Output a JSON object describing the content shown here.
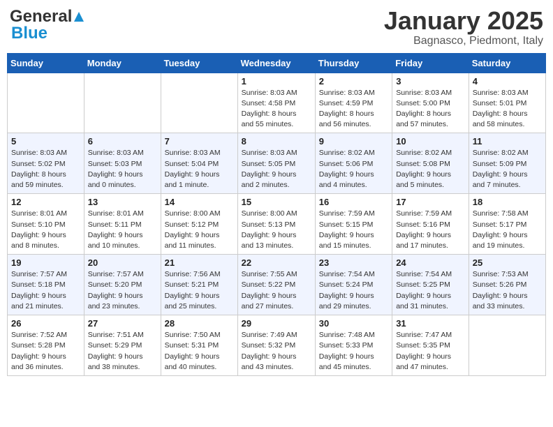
{
  "header": {
    "logo_general": "General",
    "logo_blue": "Blue",
    "month_title": "January 2025",
    "subtitle": "Bagnasco, Piedmont, Italy"
  },
  "weekdays": [
    "Sunday",
    "Monday",
    "Tuesday",
    "Wednesday",
    "Thursday",
    "Friday",
    "Saturday"
  ],
  "weeks": [
    [
      {
        "day": "",
        "info": ""
      },
      {
        "day": "",
        "info": ""
      },
      {
        "day": "",
        "info": ""
      },
      {
        "day": "1",
        "info": "Sunrise: 8:03 AM\nSunset: 4:58 PM\nDaylight: 8 hours\nand 55 minutes."
      },
      {
        "day": "2",
        "info": "Sunrise: 8:03 AM\nSunset: 4:59 PM\nDaylight: 8 hours\nand 56 minutes."
      },
      {
        "day": "3",
        "info": "Sunrise: 8:03 AM\nSunset: 5:00 PM\nDaylight: 8 hours\nand 57 minutes."
      },
      {
        "day": "4",
        "info": "Sunrise: 8:03 AM\nSunset: 5:01 PM\nDaylight: 8 hours\nand 58 minutes."
      }
    ],
    [
      {
        "day": "5",
        "info": "Sunrise: 8:03 AM\nSunset: 5:02 PM\nDaylight: 8 hours\nand 59 minutes."
      },
      {
        "day": "6",
        "info": "Sunrise: 8:03 AM\nSunset: 5:03 PM\nDaylight: 9 hours\nand 0 minutes."
      },
      {
        "day": "7",
        "info": "Sunrise: 8:03 AM\nSunset: 5:04 PM\nDaylight: 9 hours\nand 1 minute."
      },
      {
        "day": "8",
        "info": "Sunrise: 8:03 AM\nSunset: 5:05 PM\nDaylight: 9 hours\nand 2 minutes."
      },
      {
        "day": "9",
        "info": "Sunrise: 8:02 AM\nSunset: 5:06 PM\nDaylight: 9 hours\nand 4 minutes."
      },
      {
        "day": "10",
        "info": "Sunrise: 8:02 AM\nSunset: 5:08 PM\nDaylight: 9 hours\nand 5 minutes."
      },
      {
        "day": "11",
        "info": "Sunrise: 8:02 AM\nSunset: 5:09 PM\nDaylight: 9 hours\nand 7 minutes."
      }
    ],
    [
      {
        "day": "12",
        "info": "Sunrise: 8:01 AM\nSunset: 5:10 PM\nDaylight: 9 hours\nand 8 minutes."
      },
      {
        "day": "13",
        "info": "Sunrise: 8:01 AM\nSunset: 5:11 PM\nDaylight: 9 hours\nand 10 minutes."
      },
      {
        "day": "14",
        "info": "Sunrise: 8:00 AM\nSunset: 5:12 PM\nDaylight: 9 hours\nand 11 minutes."
      },
      {
        "day": "15",
        "info": "Sunrise: 8:00 AM\nSunset: 5:13 PM\nDaylight: 9 hours\nand 13 minutes."
      },
      {
        "day": "16",
        "info": "Sunrise: 7:59 AM\nSunset: 5:15 PM\nDaylight: 9 hours\nand 15 minutes."
      },
      {
        "day": "17",
        "info": "Sunrise: 7:59 AM\nSunset: 5:16 PM\nDaylight: 9 hours\nand 17 minutes."
      },
      {
        "day": "18",
        "info": "Sunrise: 7:58 AM\nSunset: 5:17 PM\nDaylight: 9 hours\nand 19 minutes."
      }
    ],
    [
      {
        "day": "19",
        "info": "Sunrise: 7:57 AM\nSunset: 5:18 PM\nDaylight: 9 hours\nand 21 minutes."
      },
      {
        "day": "20",
        "info": "Sunrise: 7:57 AM\nSunset: 5:20 PM\nDaylight: 9 hours\nand 23 minutes."
      },
      {
        "day": "21",
        "info": "Sunrise: 7:56 AM\nSunset: 5:21 PM\nDaylight: 9 hours\nand 25 minutes."
      },
      {
        "day": "22",
        "info": "Sunrise: 7:55 AM\nSunset: 5:22 PM\nDaylight: 9 hours\nand 27 minutes."
      },
      {
        "day": "23",
        "info": "Sunrise: 7:54 AM\nSunset: 5:24 PM\nDaylight: 9 hours\nand 29 minutes."
      },
      {
        "day": "24",
        "info": "Sunrise: 7:54 AM\nSunset: 5:25 PM\nDaylight: 9 hours\nand 31 minutes."
      },
      {
        "day": "25",
        "info": "Sunrise: 7:53 AM\nSunset: 5:26 PM\nDaylight: 9 hours\nand 33 minutes."
      }
    ],
    [
      {
        "day": "26",
        "info": "Sunrise: 7:52 AM\nSunset: 5:28 PM\nDaylight: 9 hours\nand 36 minutes."
      },
      {
        "day": "27",
        "info": "Sunrise: 7:51 AM\nSunset: 5:29 PM\nDaylight: 9 hours\nand 38 minutes."
      },
      {
        "day": "28",
        "info": "Sunrise: 7:50 AM\nSunset: 5:31 PM\nDaylight: 9 hours\nand 40 minutes."
      },
      {
        "day": "29",
        "info": "Sunrise: 7:49 AM\nSunset: 5:32 PM\nDaylight: 9 hours\nand 43 minutes."
      },
      {
        "day": "30",
        "info": "Sunrise: 7:48 AM\nSunset: 5:33 PM\nDaylight: 9 hours\nand 45 minutes."
      },
      {
        "day": "31",
        "info": "Sunrise: 7:47 AM\nSunset: 5:35 PM\nDaylight: 9 hours\nand 47 minutes."
      },
      {
        "day": "",
        "info": ""
      }
    ]
  ]
}
